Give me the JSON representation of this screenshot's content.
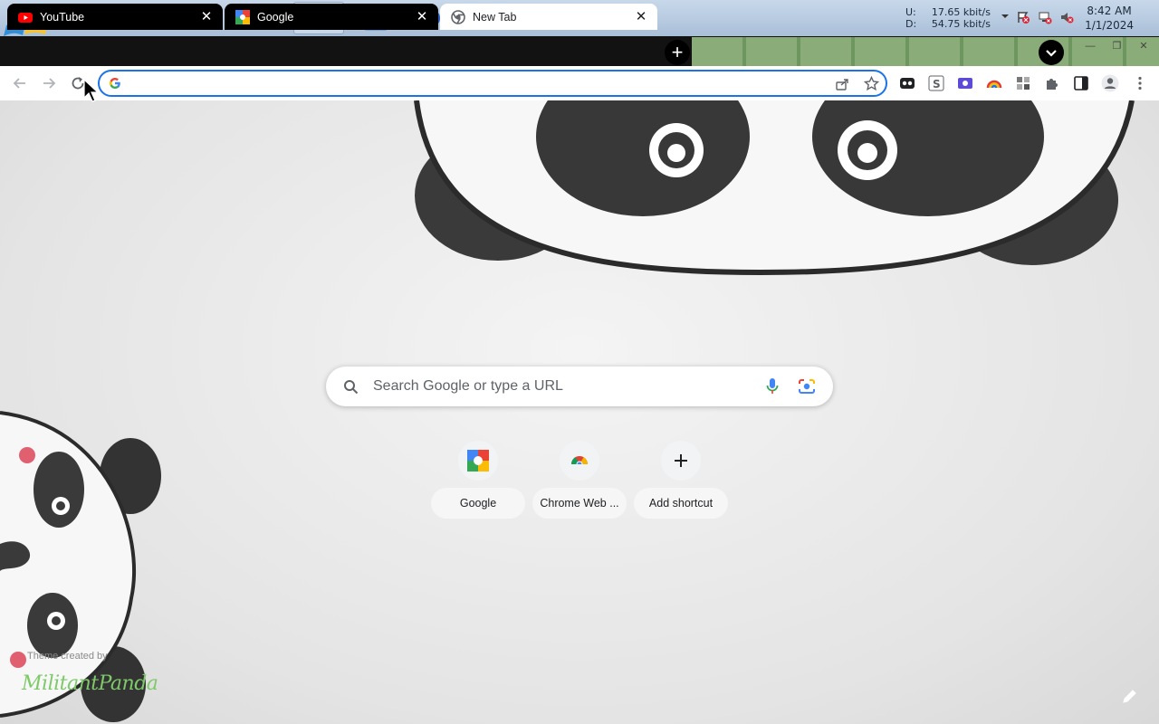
{
  "taskbar": {
    "apps": [
      {
        "name": "windows-explorer-icon"
      },
      {
        "name": "media-player-icon"
      },
      {
        "name": "internet-explorer-icon"
      },
      {
        "name": "file-explorer-icon"
      },
      {
        "name": "chrome-icon",
        "active": true
      },
      {
        "name": "photoshop-icon"
      },
      {
        "name": "infinity-app-icon"
      }
    ],
    "network": {
      "up_label": "U:",
      "up_value": "17.65 kbit/s",
      "down_label": "D:",
      "down_value": "54.75 kbit/s"
    },
    "clock": {
      "time": "8:42 AM",
      "date": "1/1/2024"
    }
  },
  "tabs": [
    {
      "title": "YouTube",
      "icon": "youtube-icon"
    },
    {
      "title": "Google",
      "icon": "google-icon"
    },
    {
      "title": "New Tab",
      "icon": "chrome-icon",
      "active": true
    }
  ],
  "toolbar": {
    "omnibox_value": ""
  },
  "ntp": {
    "search_placeholder": "Search Google or type a URL",
    "shortcuts": [
      {
        "label": "Google",
        "icon": "google-icon"
      },
      {
        "label": "Chrome Web ...",
        "icon": "chrome-web-store-icon"
      },
      {
        "label": "Add shortcut",
        "icon": "plus-icon"
      }
    ],
    "theme_credit": "Theme created by",
    "theme_author": "MilitantPanda"
  },
  "colors": {
    "accent": "#1a73e8",
    "tabstrip": "#121212",
    "theme_green": "#7ec96a"
  }
}
